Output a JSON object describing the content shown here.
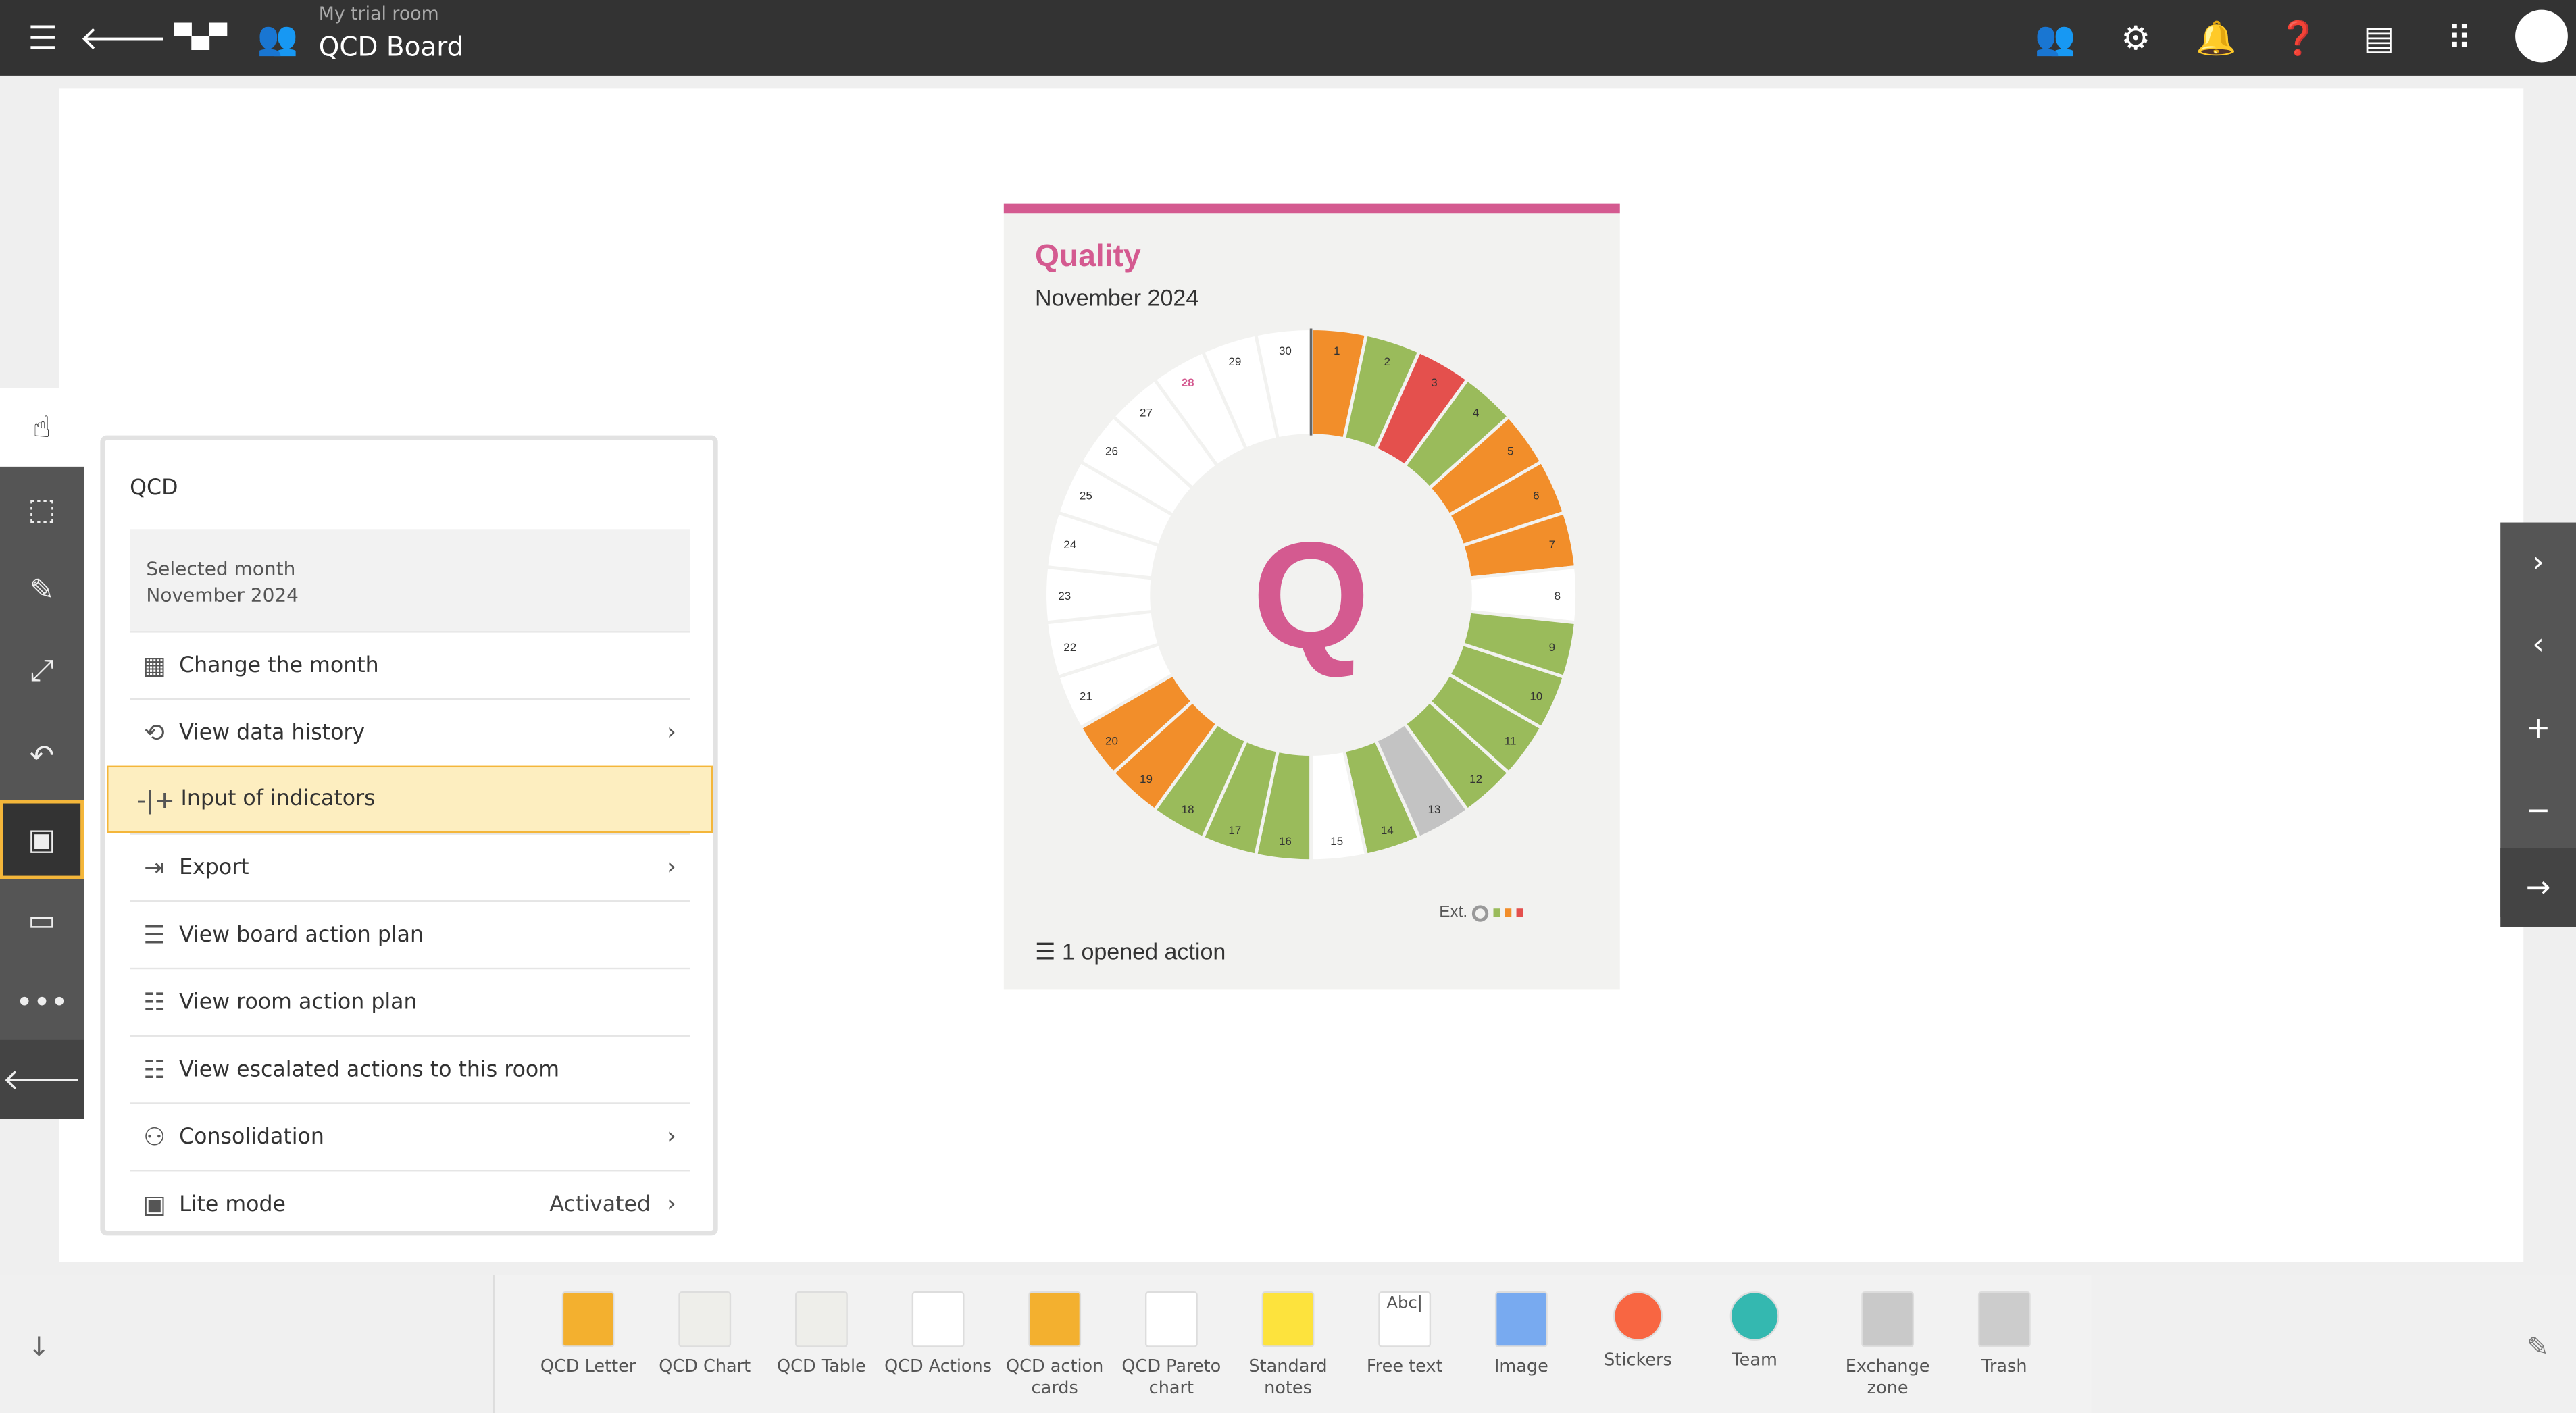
{
  "topbar": {
    "room": "My trial room",
    "board": "QCD Board",
    "icons": [
      "menu-icon",
      "back-arrow-icon",
      "layout-icon",
      "team-icon",
      "users-icon",
      "gear-icon",
      "bell-icon",
      "help-icon",
      "notes-icon",
      "apps-grid-icon",
      "avatar"
    ]
  },
  "menu": {
    "title": "QCD",
    "selected_label": "Selected month",
    "selected_value": "November 2024",
    "items": [
      {
        "label": "Change the month",
        "icon": "calendar-icon",
        "chevron": false
      },
      {
        "label": "View data history",
        "icon": "history-icon",
        "chevron": true
      },
      {
        "label": "Input of indicators",
        "icon": "input-icon",
        "chevron": false,
        "highlighted": true
      },
      {
        "label": "Export",
        "icon": "export-icon",
        "chevron": true
      },
      {
        "label": "View board action plan",
        "icon": "list-icon",
        "chevron": false
      },
      {
        "label": "View room action plan",
        "icon": "room-plan-icon",
        "chevron": false
      },
      {
        "label": "View escalated actions to this room",
        "icon": "escalated-icon",
        "chevron": false
      },
      {
        "label": "Consolidation",
        "icon": "hierarchy-icon",
        "chevron": true
      },
      {
        "label": "Lite mode",
        "icon": "lite-mode-icon",
        "chevron": true,
        "value": "Activated"
      }
    ]
  },
  "card": {
    "title": "Quality",
    "month": "November 2024",
    "letter": "Q",
    "ext_label": "Ext.",
    "actions": "1 opened action",
    "accent": "#d45a90",
    "colors": {
      "green": "#9abb5b",
      "orange": "#f28e2a",
      "red": "#e4504d",
      "gray": "#c3c3c3",
      "empty": "#ffffff"
    },
    "today": 28,
    "days": [
      "orange",
      "green",
      "red",
      "green",
      "orange",
      "orange",
      "orange",
      "empty",
      "green",
      "green",
      "green",
      "green",
      "gray",
      "green",
      "empty",
      "green",
      "green",
      "green",
      "orange",
      "orange",
      "empty",
      "empty",
      "empty",
      "empty",
      "empty",
      "empty",
      "empty",
      "empty",
      "empty",
      "empty"
    ]
  },
  "tray": [
    {
      "label": "QCD Letter",
      "color": "#f3b02f"
    },
    {
      "label": "QCD Chart",
      "color": "#eeeeea"
    },
    {
      "label": "QCD Table",
      "color": "#eeeeea"
    },
    {
      "label": "QCD Actions",
      "color": "#ffffff"
    },
    {
      "label": "QCD action cards",
      "color": "#f3b02f"
    },
    {
      "label": "QCD Pareto chart",
      "color": "#ffffff"
    },
    {
      "label": "Standard notes",
      "color": "#fde33d"
    },
    {
      "label": "Free text",
      "color": "#ffffff",
      "text": "Abc|"
    },
    {
      "label": "Image",
      "color": "#78aaf0"
    },
    {
      "label": "Stickers",
      "color": "#f86642"
    },
    {
      "label": "Team",
      "color": "#34b8b0"
    },
    {
      "label": "Exchange zone",
      "color": "#c9c9c9"
    },
    {
      "label": "Trash",
      "color": "#cccccc"
    }
  ]
}
